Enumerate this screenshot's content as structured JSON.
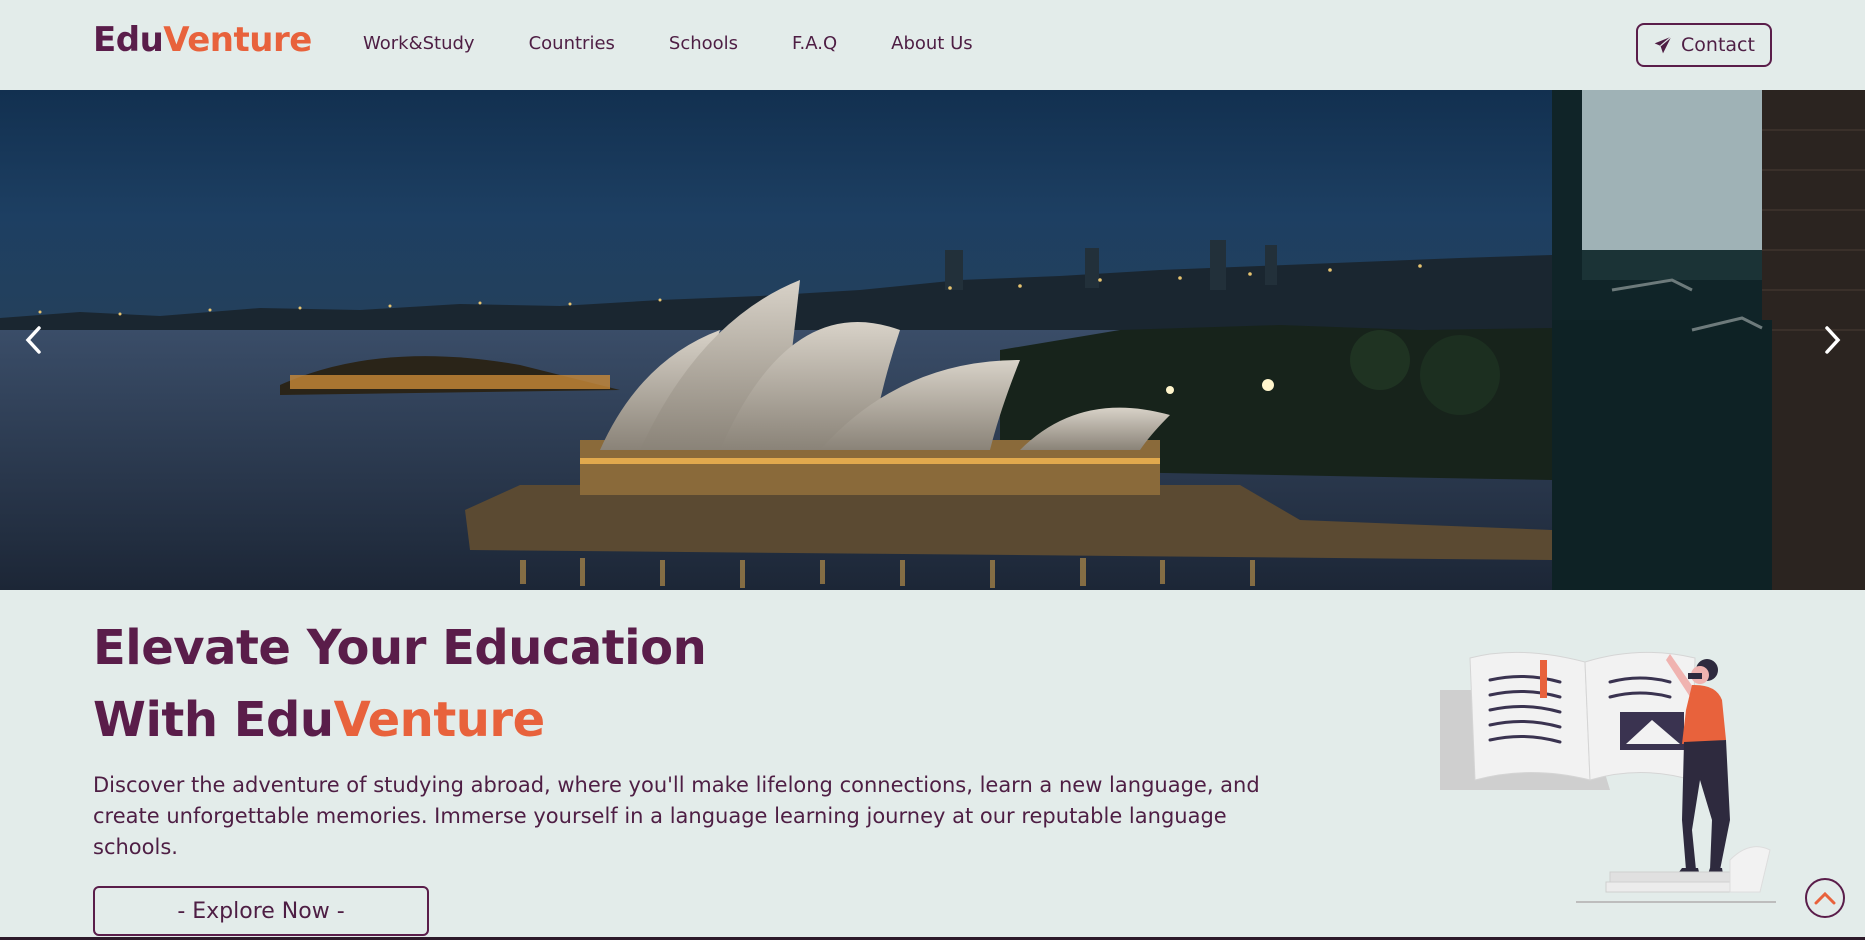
{
  "brand": {
    "part1": "Edu",
    "part2": "Venture"
  },
  "nav": {
    "items": [
      "Work&Study",
      "Countries",
      "Schools",
      "F.A.Q",
      "About Us"
    ],
    "contact_label": "Contact"
  },
  "hero": {
    "title_line1": "Elevate Your Education",
    "title_line2_prefix": "With ",
    "title_brand_part1": "Edu",
    "title_brand_part2": "Venture",
    "description": "Discover the adventure of studying abroad, where you'll make lifelong connections, learn a new language, and create unforgettable memories. Immerse yourself in a language learning journey at our reputable language schools.",
    "cta_label": "- Explore Now -"
  },
  "colors": {
    "background": "#e3ecea",
    "primary": "#5a1d4a",
    "accent": "#e8623c"
  },
  "icons": {
    "contact": "paper-plane-icon",
    "carousel_prev": "chevron-left-icon",
    "carousel_next": "chevron-right-icon",
    "scroll_top": "chevron-up-icon"
  }
}
